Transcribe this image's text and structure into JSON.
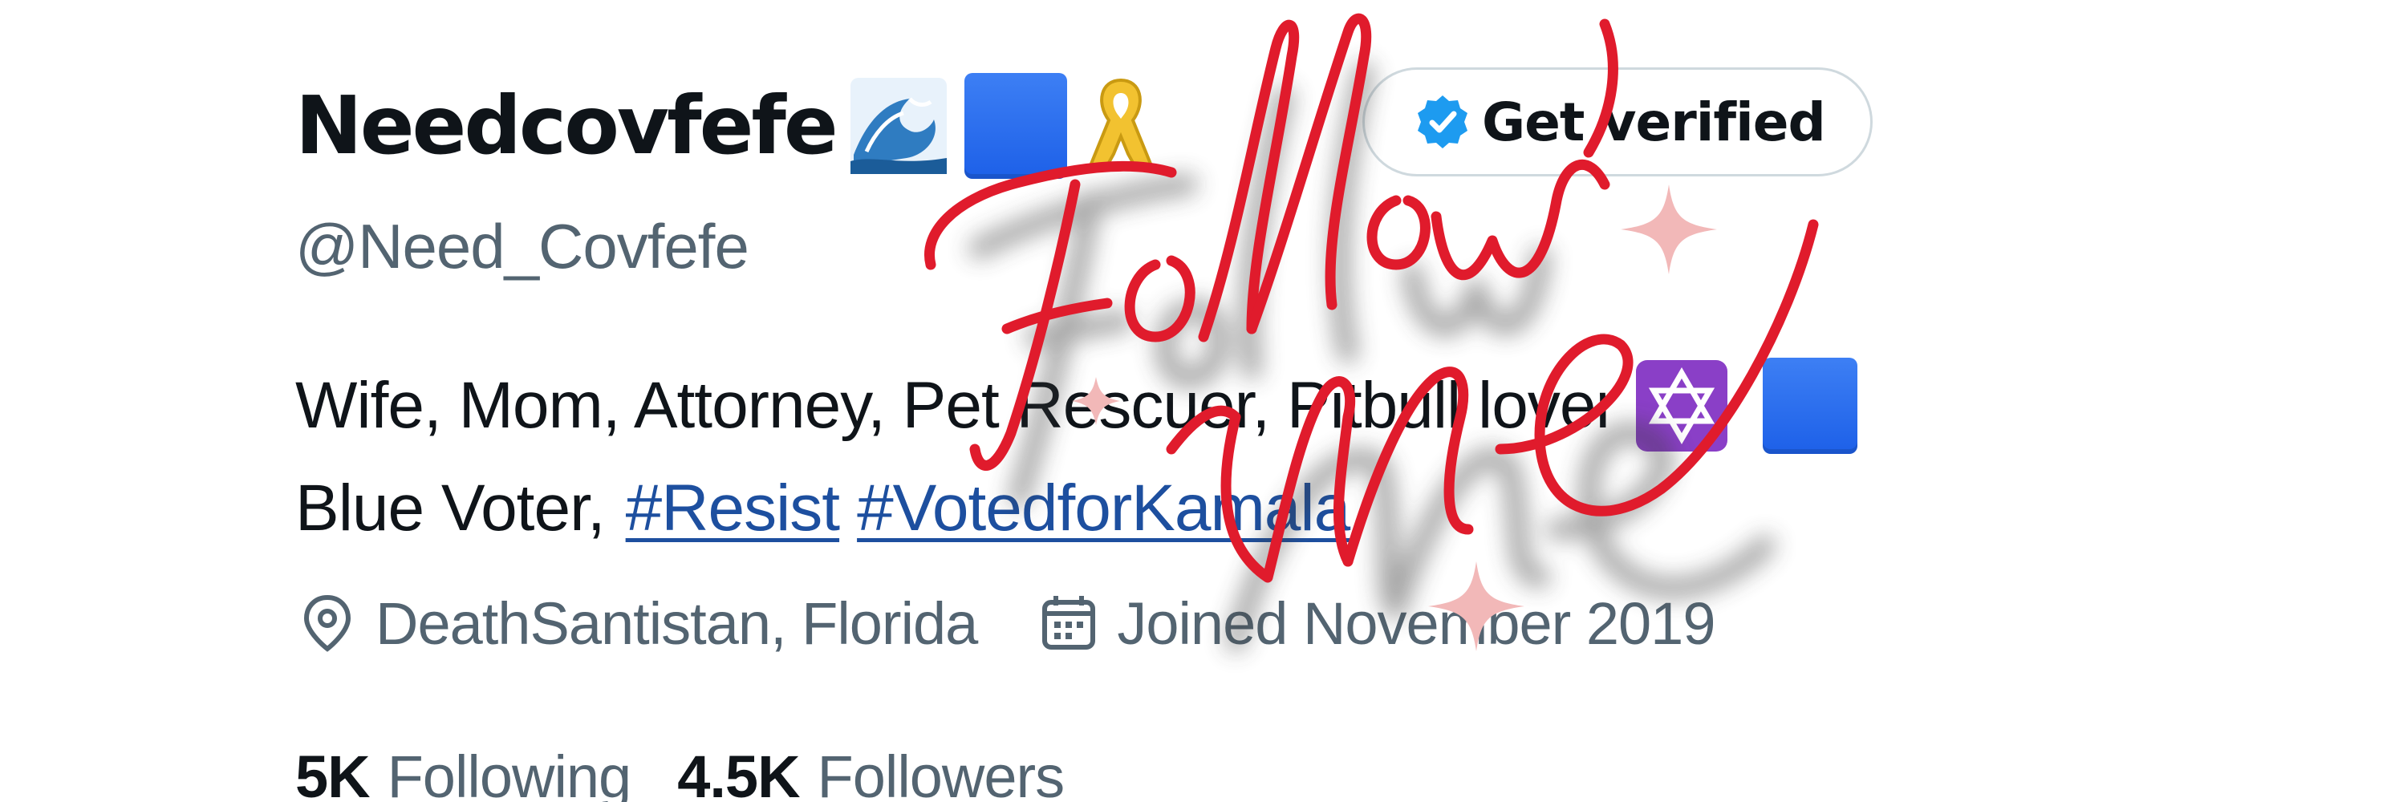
{
  "profile": {
    "display_name": "Needcovfefe",
    "handle": "@Need_Covfefe",
    "get_verified_label": "Get verified",
    "bio_line1": "Wife, Mom, Attorney, Pet Rescuer, Pitbull lover",
    "bio_line2_prefix": "Blue Voter,",
    "hashtags": [
      "#Resist",
      "#VotedforKamala"
    ],
    "location": "DeathSantistan, Florida",
    "joined": "Joined November 2019",
    "following_count": "5K",
    "following_label": "Following",
    "followers_count": "4.5K",
    "followers_label": "Followers"
  },
  "emojis": {
    "name_emojis": [
      "wave",
      "blue-square",
      "yellow-ribbon"
    ],
    "bio_emojis": [
      "star-of-david",
      "blue-square"
    ]
  },
  "overlay": {
    "handwriting": [
      "Follow",
      "Me"
    ],
    "handwriting_color": "#e01b2c"
  },
  "colors": {
    "text_primary": "#0f1419",
    "text_secondary": "#536471",
    "link": "#1d4f9f",
    "verified_badge": "#1d9bf0",
    "blue_square": "#2369ec"
  }
}
